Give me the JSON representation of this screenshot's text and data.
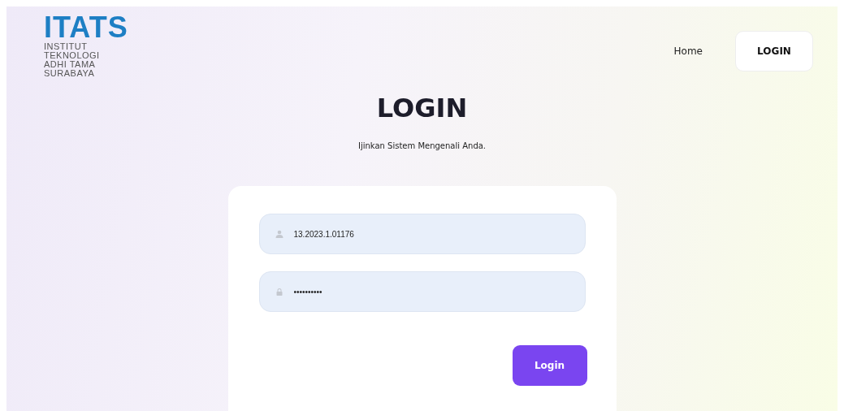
{
  "logo": {
    "mark": "ITATS",
    "lines": [
      "INSTITUT",
      "TEKNOLOGI",
      "ADHI TAMA",
      "SURABAYA"
    ]
  },
  "nav": {
    "home": "Home",
    "login": "LOGIN"
  },
  "heading": "LOGIN",
  "subtitle": "Ijinkan Sistem Mengenali Anda.",
  "form": {
    "username": "13.2023.1.01176",
    "password": "••••••••••",
    "submit": "Login"
  }
}
